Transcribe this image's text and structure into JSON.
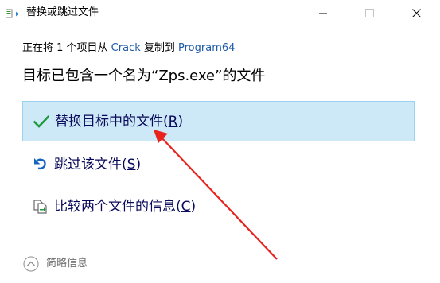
{
  "window": {
    "title": "替换或跳过文件",
    "icon": "file-move-icon"
  },
  "controls": {
    "minimize_icon": "minimize-icon",
    "maximize_icon": "maximize-icon",
    "close_icon": "close-icon"
  },
  "status": {
    "prefix": "正在将 1 个项目从 ",
    "source": "Crack",
    "middle": " 复制到 ",
    "destination": "Program64"
  },
  "heading": {
    "text": "目标已包含一个名为“Zps.exe”的文件"
  },
  "options": [
    {
      "icon": "checkmark-icon",
      "label": "替换目标中的文件(",
      "accelerator": "R",
      "suffix": ")"
    },
    {
      "icon": "skip-arrow-icon",
      "label": "跳过该文件(",
      "accelerator": "S",
      "suffix": ")"
    },
    {
      "icon": "compare-files-icon",
      "label": "比较两个文件的信息(",
      "accelerator": "C",
      "suffix": ")"
    }
  ],
  "footer": {
    "details_label": "简略信息",
    "details_icon": "chevron-up-circle-icon"
  },
  "annotation": {
    "arrow_color": "#e8231e"
  },
  "colors": {
    "link": "#1e5aa8",
    "selected_bg": "#cde8f7",
    "selected_border": "#99d1ef",
    "option_text": "#0a0a5a",
    "check_green": "#1e9a3c",
    "skip_blue": "#1565c0"
  }
}
